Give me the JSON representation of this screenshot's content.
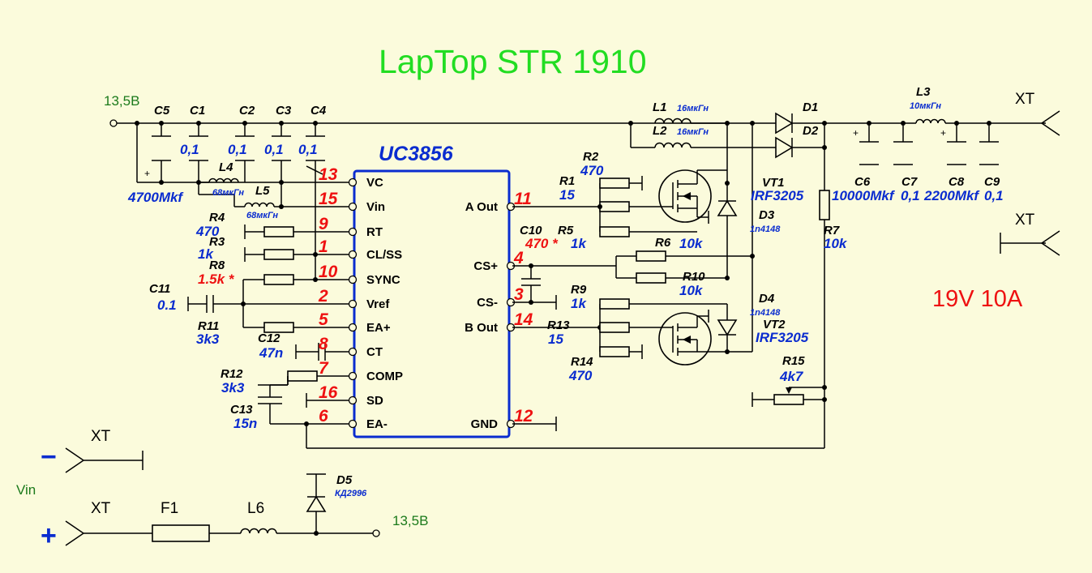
{
  "title": "LapTop STR 1910",
  "output_rating": "19V  10A",
  "ic": {
    "name": "UC3856"
  },
  "rail_label": "13,5В",
  "input_label": "Vin",
  "minus_sign": "−",
  "plus_sign": "+",
  "xt_label": "XT",
  "ic_pins_left": [
    {
      "num": "13",
      "name": "VC"
    },
    {
      "num": "15",
      "name": "Vin"
    },
    {
      "num": "9",
      "name": "RT"
    },
    {
      "num": "1",
      "name": "CL/SS"
    },
    {
      "num": "10",
      "name": "SYNC"
    },
    {
      "num": "2",
      "name": "Vref"
    },
    {
      "num": "5",
      "name": "EA+"
    },
    {
      "num": "8",
      "name": "CT"
    },
    {
      "num": "7",
      "name": "COMP"
    },
    {
      "num": "16",
      "name": "SD"
    },
    {
      "num": "6",
      "name": "EA-"
    }
  ],
  "ic_pins_right": [
    {
      "num": "11",
      "name": "A Out"
    },
    {
      "num": "4",
      "name": "CS+"
    },
    {
      "num": "3",
      "name": "CS-"
    },
    {
      "num": "14",
      "name": "B Out"
    },
    {
      "num": "12",
      "name": "GND"
    }
  ],
  "components": {
    "C5": {
      "ref": "C5",
      "value": "4700Mkf"
    },
    "C1": {
      "ref": "C1",
      "value": "0,1"
    },
    "C2": {
      "ref": "C2",
      "value": "0,1"
    },
    "C3": {
      "ref": "C3",
      "value": "0,1"
    },
    "C4": {
      "ref": "C4",
      "value": "0,1"
    },
    "L4": {
      "ref": "L4",
      "value": "68мкГн"
    },
    "L5": {
      "ref": "L5",
      "value": "68мкГн"
    },
    "R4": {
      "ref": "R4",
      "value": "470"
    },
    "R3": {
      "ref": "R3",
      "value": "1k"
    },
    "R8": {
      "ref": "R8",
      "value": "1.5k *"
    },
    "C11": {
      "ref": "C11",
      "value": "0.1"
    },
    "R11": {
      "ref": "R11",
      "value": "3k3"
    },
    "C12": {
      "ref": "C12",
      "value": "47n"
    },
    "R12": {
      "ref": "R12",
      "value": "3k3"
    },
    "C13": {
      "ref": "C13",
      "value": "15n"
    },
    "R2": {
      "ref": "R2",
      "value": "470"
    },
    "R1": {
      "ref": "R1",
      "value": "15"
    },
    "R5": {
      "ref": "R5",
      "value": "1k"
    },
    "C10": {
      "ref": "C10",
      "value": "470 *"
    },
    "R6": {
      "ref": "R6",
      "value": "10k"
    },
    "R10": {
      "ref": "R10",
      "value": "10k"
    },
    "R9": {
      "ref": "R9",
      "value": "1k"
    },
    "R13": {
      "ref": "R13",
      "value": "15"
    },
    "R14": {
      "ref": "R14",
      "value": "470"
    },
    "L1": {
      "ref": "L1",
      "value": "16мкГн"
    },
    "L2": {
      "ref": "L2",
      "value": "16мкГн"
    },
    "D1": {
      "ref": "D1"
    },
    "D2": {
      "ref": "D2"
    },
    "VT1": {
      "ref": "VT1",
      "value": "IRF3205"
    },
    "VT2": {
      "ref": "VT2",
      "value": "IRF3205"
    },
    "D3": {
      "ref": "D3",
      "value": "1n4148"
    },
    "D4": {
      "ref": "D4",
      "value": "1n4148"
    },
    "R7": {
      "ref": "R7",
      "value": "10k"
    },
    "R15": {
      "ref": "R15",
      "value": "4k7"
    },
    "L3": {
      "ref": "L3",
      "value": "10мкГн"
    },
    "C6": {
      "ref": "C6",
      "value": "10000Mkf"
    },
    "C7": {
      "ref": "C7",
      "value": "0,1"
    },
    "C8": {
      "ref": "C8",
      "value": "2200Mkf"
    },
    "C9": {
      "ref": "C9",
      "value": "0,1"
    },
    "D5": {
      "ref": "D5",
      "value": "КД2996"
    },
    "F1": {
      "ref": "F1"
    },
    "L6": {
      "ref": "L6"
    }
  },
  "colors": {
    "background": "#fbfbdc",
    "title": "#22dd22",
    "ic_outline": "#0a2ccf",
    "pin_numbers": "#ee1111",
    "values": "#0a2ccf"
  }
}
